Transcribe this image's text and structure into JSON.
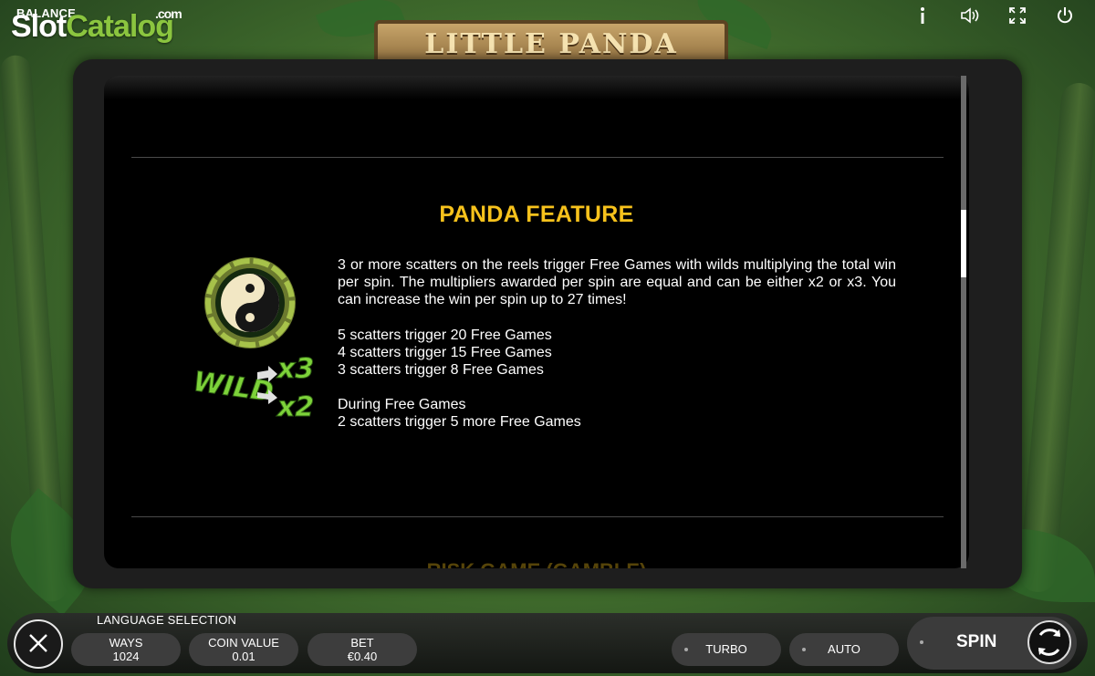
{
  "watermark": {
    "balance_label": "BALANCE",
    "logo_part1": "Slot",
    "logo_part2": "Catalog",
    "logo_suffix": ".com"
  },
  "game": {
    "title": "LITTLE PANDA"
  },
  "top_controls": {
    "info_icon": "info-icon",
    "sound_icon": "sound-icon",
    "fullscreen_icon": "fullscreen-icon",
    "power_icon": "power-icon"
  },
  "paytable": {
    "section_title": "PANDA FEATURE",
    "paragraph": "3 or more scatters on the reels trigger Free Games with wilds multiplying the total win per spin. The multipliers awarded per spin are equal and can be either x2 or x3. You can increase the win per spin up to 27 times!",
    "scatter_lines": [
      "5 scatters trigger 20 Free Games",
      "4 scatters trigger 15 Free Games",
      "3 scatters trigger 8 Free Games"
    ],
    "free_games_heading": "During Free Games",
    "free_games_line": "2 scatters trigger 5 more Free Games",
    "next_section_title": "RISK GAME (GAMBLE)",
    "illustration": {
      "wild_text": "WILD",
      "mult_top": "x3",
      "mult_bottom": "x2"
    }
  },
  "bottom_bar": {
    "language_label": "LANGUAGE SELECTION",
    "ways": {
      "label": "WAYS",
      "value": "1024"
    },
    "coin_value": {
      "label": "COIN VALUE",
      "value": "0.01"
    },
    "bet": {
      "label": "BET",
      "value": "€0.40"
    },
    "turbo_label": "TURBO",
    "auto_label": "AUTO",
    "spin_label": "SPIN"
  },
  "colors": {
    "accent": "#f7c21c",
    "wild_green": "#7dd23a",
    "panel": "#000000"
  }
}
